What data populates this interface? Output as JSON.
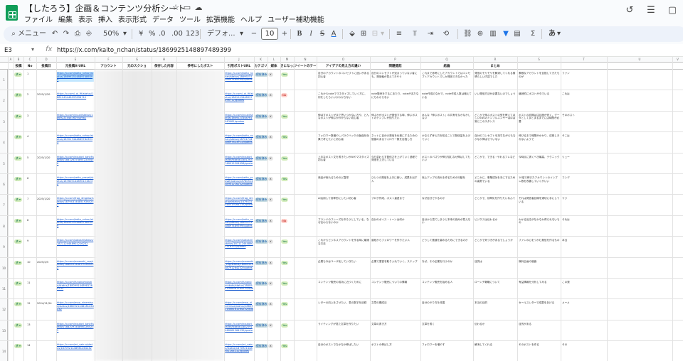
{
  "title": "【したろう】企画＆コンテンツ分析シート",
  "menu": [
    "ファイル",
    "編集",
    "表示",
    "挿入",
    "表示形式",
    "データ",
    "ツール",
    "拡張機能",
    "ヘルプ",
    "ユーザー補助機能"
  ],
  "toolbar": {
    "search_label": "メニュー",
    "zoom": "50%",
    "currency": "¥",
    "percent": "%",
    "dec_dec": ".0",
    "dec_inc": ".00",
    "format_123": "123",
    "font": "デフォ...",
    "font_size": "10",
    "minus": "−",
    "plus": "+",
    "bold": "B",
    "italic": "I",
    "strike": "S",
    "text_color": "A",
    "sigma": "Σ"
  },
  "formula_bar": {
    "cell_ref": "E3",
    "fx": "fx",
    "value": "https://x.com/kaito_nchan/status/1869925148897489399"
  },
  "columns": {
    "letters": [
      "A",
      "B",
      "C",
      "D",
      "E",
      "F",
      "G",
      "H",
      "I",
      "J",
      "K",
      "L",
      "M",
      "N",
      "O",
      "P",
      "Q",
      "R",
      "S",
      "T",
      "U",
      "V"
    ],
    "headers": [
      "投稿",
      "No",
      "投稿日",
      "元投稿X-URL",
      "アカウント",
      "元のスクショ",
      "保存した内容",
      "参考にしたポスト",
      "引用ポストURL",
      "カテゴリ",
      "媒体",
      "きになった",
      "ツイートのテーマ",
      "アイデアの見え方の違い",
      "問題提起",
      "結論",
      "まとめ"
    ]
  },
  "rows": [
    {
      "n": "1",
      "no": "1",
      "date": "",
      "url": "https://x.com/kaito_nchan/status/1869925148897489399",
      "qurl": "https://x.com/kaito_nchan/status/1869925148897489399/quotes",
      "cat": "保存済み",
      "med": "X",
      "flag": "Yes",
      "flag_red": false,
      "t1": "自分のアカウントのコンセプトに迷いがある初心者",
      "t2": "自分のコンセプトが定まっていない者にも、発信軸が見えてきそう",
      "t3": "これまで参考にしたアカウントではコンセプトアカウントでしか発信できなかった",
      "t4": "発信のモヤモヤを解消してくれる素晴らしい内容でした",
      "t5": "素敵なアカウントを目指してきたものが",
      "t6": "ファン"
    },
    {
      "n": "2",
      "no": "2",
      "date": "2025/1/20",
      "url": "https://x.com/_ai_fit/status/1881243448997896712",
      "qurl": "https://x.com/_ai_fit/status/1881243448997896712/quotes",
      "cat": "保存済み",
      "med": "X",
      "flag": "No",
      "flag_red": true,
      "t1": "これからnoteでマネタイズしていく方に、何をしたらいいかわからない",
      "t2": "note販売をするにあたり、noteがまだなにもわからない",
      "t3": "note作成のなかで、note作成人数は増えている",
      "t4": "いい発信方法が必要ないのでしょう",
      "t5": "継続的にポストが今でいる",
      "t6": "これは"
    },
    {
      "n": "3",
      "no": "3",
      "date": "",
      "url": "https://x.com/yuuki/status/1869221448761943981",
      "qurl": "https://x.com/yuuki/status/1869221448761943981/quotes",
      "cat": "保存済み",
      "med": "X",
      "flag": "Yes",
      "flag_red": false,
      "t1": "伸ばすポストがまだ思いつかない方や、どんなポストが伸ぶかわからない初心者",
      "t2": "伸ぶかがポストが発信する時、伸ぶポストのテンプレが知りたい",
      "t3": "みんな「伸ぶポスト」の共有をなかなかしない",
      "t4": "どこかで伸ぶポストの型を教えてほしいSNSのインフルエンサーはほぼ常にこのスタンス",
      "t5": "ポストの初期は注目度が低く、データとしてまとまるまでには時間が必要",
      "t6": "そのポスト"
    },
    {
      "n": "4",
      "no": "4",
      "date": "",
      "url": "https://x.com/kaito_nchan/status/1870174448697823911",
      "qurl": "https://x.com/kaito_nchan/status/1870174448697823911/quotes",
      "cat": "保存済み",
      "med": "X",
      "flag": "Yes",
      "flag_red": false,
      "t1": "フォロワー数増やしパラクハックの勉強を効果で考えたいと初心者",
      "t2": "ネットに自分の発信を仕事にするための価値のあるフォロワー数を目指し方",
      "t3": "かならず考え方を知ることで発信量を上げていく",
      "t4": "自分のコンセプトを持ちながらもなかなか伸ばせていない",
      "t5": "伸びるまで時間がかかり、成長しきれないようで",
      "t6": "そこは"
    },
    {
      "n": "5",
      "no": "5",
      "date": "2025/1/20",
      "url": "https://x.com/noutori_tankf/status/1881263748912204456",
      "qurl": "https://x.com/noutori_tankf/status/1881263748912204456/quotes",
      "cat": "保存済み",
      "med": "X",
      "flag": "Yes",
      "flag_red": false,
      "t1": "上手なポスト文を書きたいがAIやマネタイズ初心者",
      "t2": "今も変わらず発信力を上げていく過程で発信を工夫している",
      "t3": "ポストのバズりが伸び悩むなぜ伸ばしてもいい",
      "t4": "どこかで、できる・やれるフレなど",
      "t5": "今時点に書くべき最高、テクニック",
      "t6": "リュー"
    },
    {
      "n": "6",
      "no": "6",
      "date": "",
      "url": "https://x.com/seito_prasat/status/1876051448901216232",
      "qurl": "https://x.com/seito_prasat/status/1876051448901216232/quotes",
      "cat": "保存済み",
      "med": "X",
      "flag": "Yes",
      "flag_red": false,
      "t1": "商品が売れるためのど直球",
      "t2": "ひとつの発信を上手に使い、成果を出す人",
      "t3": "売上アップの流れを作るための行動を",
      "t4": "どこかに、事業成功を手にするための姿勢でいる",
      "t5": "10倍で伸びたアカウントのインプレ数を改善していくがいい",
      "t6": "コンデ"
    },
    {
      "n": "7",
      "no": "7",
      "date": "2025/1/20",
      "url": "https://x.com/frog_4mgtaw/status/1879431448519264232",
      "qurl": "https://x.com/frog_4mgtaw/status/1879431448519264232/quotes",
      "cat": "保存済み",
      "med": "X",
      "flag": "Yes",
      "flag_red": false,
      "t1": "AI活用して効率的にしたい初心者",
      "t2": "ブログ作成、ポスト量産まで",
      "t3": "なぜ自分でやるのか",
      "t4": "どこかで、効率化を作りたいなんて",
      "t5": "それは発信者目線を適切に手にしている",
      "t6": "ヤジ"
    },
    {
      "n": "8",
      "no": "8",
      "date": "",
      "url": "https://x.com/kaito_nchan/status/1869925148897489399",
      "qurl": "https://x.com/kaito_nchan/status/1869925148897489399/quotes",
      "cat": "保存済み",
      "med": "X",
      "flag": "No",
      "flag_red": true,
      "t1": "ブランドのフレーズを作ろうとしている。なぜ伝わらないのか",
      "t2": "自分のボイス・トーンは何か",
      "t3": "自分から見てしまうと本来の強みが見えない",
      "t4": "ビジネスは伝わるか",
      "t5": "わかる反応がなかなか得られないもの",
      "t6": "それは"
    },
    {
      "n": "9",
      "no": "9",
      "date": "",
      "url": "https://x.com/satoshi/status/1871124448901216232",
      "qurl": "https://x.com/satoshi/status/1871124448901216232/quotes",
      "cat": "保存済み",
      "med": "X",
      "flag": "Yes",
      "flag_red": false,
      "t1": "これからビジネスアカウントを作る時に最適な方法",
      "t2": "普段からフォロワーを作りたい人",
      "t3": "どうして価値を高めるためにできるのか",
      "t4": "どこかで気づきがあるでしょうか",
      "t5": "ファンの心をつかむ発信を作るもの",
      "t6": "本当"
    },
    {
      "n": "10",
      "no": "10",
      "date": "2025/2/5",
      "url": "https://x.com/masashi_cxp/status/1886551448791264232",
      "qurl": "https://x.com/masashi_cxp/status/1886551448791264232/quotes",
      "cat": "保存済み",
      "med": "X",
      "flag": "Yes",
      "flag_red": false,
      "t1": "企業も今はユーザ化していきたい",
      "t2": "企業で運営を取り入れていく。ステップ",
      "t3": "なぜ、その企業を行うのか",
      "t4": "目的は",
      "t5": "無料企画の価値",
      "t6": ""
    },
    {
      "n": "11",
      "no": "11",
      "date": "",
      "url": "https://x.com/funanomukato/status/1880991448981264232",
      "qurl": "https://x.com/funanomukato/status/1880991448981264232/quotes",
      "cat": "保存済み",
      "med": "X",
      "flag": "Yes",
      "flag_red": false,
      "t1": "コンテンツ販売の成功に近づくために",
      "t2": "コンテンツ販売についての情報",
      "t3": "コンテンツ販売を始める人",
      "t4": "ローンチ戦略について",
      "t5": "有益情報を分析してみる",
      "t6": "この発"
    },
    {
      "n": "12",
      "no": "12",
      "date": "2024/11/24",
      "url": "https://x.com/mao_ninemisss/status/1860921448181264232",
      "qurl": "https://x.com/mao_ninemisss/status/1860921448181264232/quotes",
      "cat": "保存済み",
      "med": "X",
      "flag": "Yes",
      "flag_red": false,
      "t1": "レターの向上をさせたい、表の数字を記録",
      "t2": "文章の構成法",
      "t3": "自分のやり方を改善",
      "t4": "本当の目的",
      "t5": "セールスレターで成果をあげる",
      "t6": "メーメ"
    },
    {
      "n": "13",
      "no": "13",
      "date": "",
      "url": "https://x.com/noutori_tankf/status/1882091448981264232",
      "qurl": "https://x.com/noutori_tankf/status/1882091448981264232/quotes",
      "cat": "保存済み",
      "med": "X",
      "flag": "Yes",
      "flag_red": false,
      "t1": "ライティングが見た文章を作りたい",
      "t2": "文章の書き方",
      "t3": "文章を書く",
      "t4": "伝わるか",
      "t5": "目的がある",
      "t6": ""
    },
    {
      "n": "14",
      "no": "14",
      "date": "",
      "url": "https://x.com/mi_sakuu/status/1870921448981264232",
      "qurl": "https://x.com/mi_sakuu/status/1870921448981264232/quotes",
      "cat": "保存済み",
      "med": "X",
      "flag": "Yes",
      "flag_red": false,
      "t1": "自分のポストでなかなか伸ばしたい",
      "t2": "ポストの伸ばし方",
      "t3": "フォロワーを増やす",
      "t4": "解消してくれる",
      "t5": "そのポストを作る",
      "t6": "その"
    }
  ]
}
